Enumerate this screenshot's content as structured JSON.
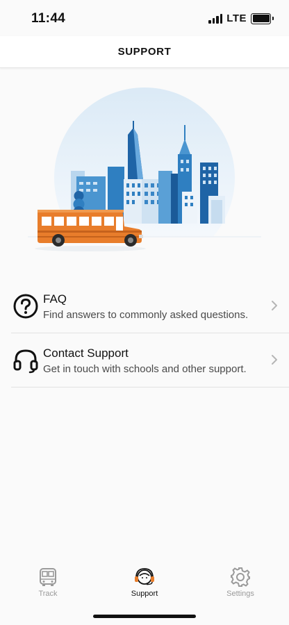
{
  "status_bar": {
    "time": "11:44",
    "network": "LTE",
    "signal_icon": "cellular-signal-icon",
    "battery_icon": "battery-icon"
  },
  "header": {
    "title": "SUPPORT"
  },
  "hero": {
    "illustration": "city-skyline-with-school-bus"
  },
  "menu": [
    {
      "icon": "question-circle-icon",
      "title": "FAQ",
      "subtitle": "Find answers to commonly asked questions."
    },
    {
      "icon": "headset-icon",
      "title": "Contact Support",
      "subtitle": "Get in touch with schools and other support."
    }
  ],
  "tab_bar": {
    "tabs": [
      {
        "label": "Track",
        "icon": "bus-icon",
        "active": false
      },
      {
        "label": "Support",
        "icon": "support-agent-icon",
        "active": true
      },
      {
        "label": "Settings",
        "icon": "gear-icon",
        "active": false
      }
    ]
  },
  "colors": {
    "accent_orange": "#e87d2b",
    "skyline_blue": "#2f7fc1",
    "text_primary": "#111111",
    "text_secondary": "#4a4a4a",
    "tab_inactive": "#9a9a9a"
  }
}
